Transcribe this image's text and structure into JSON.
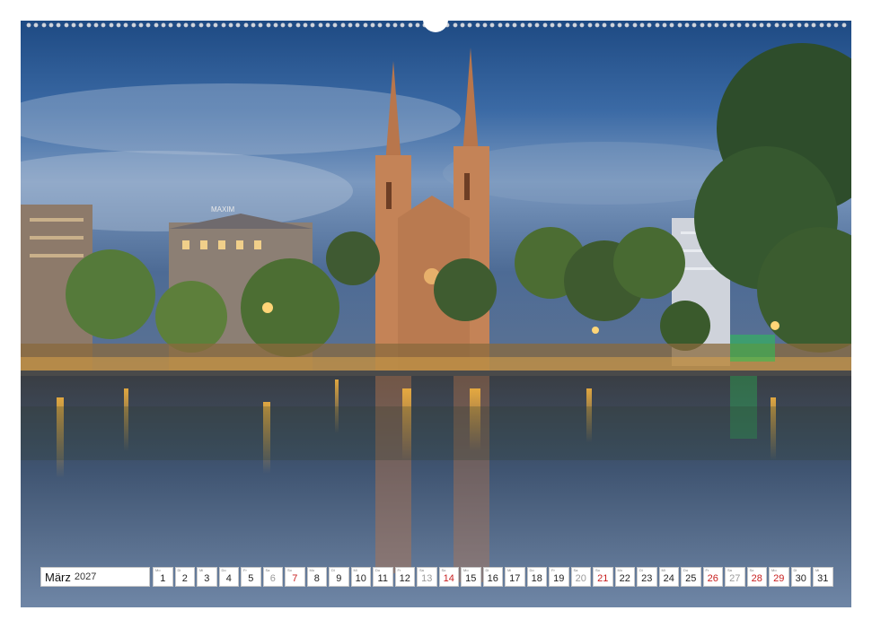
{
  "photo": {
    "description_icon": "city-night-church-reflection",
    "hotel_sign": "MAXIM"
  },
  "calendar": {
    "month": "März",
    "year": "2027",
    "days": [
      {
        "wd": "Mo",
        "n": "1",
        "type": "wd"
      },
      {
        "wd": "Di",
        "n": "2",
        "type": "wd"
      },
      {
        "wd": "Mi",
        "n": "3",
        "type": "wd"
      },
      {
        "wd": "Do",
        "n": "4",
        "type": "wd"
      },
      {
        "wd": "Fr",
        "n": "5",
        "type": "wd"
      },
      {
        "wd": "Sa",
        "n": "6",
        "type": "sat"
      },
      {
        "wd": "So",
        "n": "7",
        "type": "sun"
      },
      {
        "wd": "Mo",
        "n": "8",
        "type": "wd"
      },
      {
        "wd": "Di",
        "n": "9",
        "type": "wd"
      },
      {
        "wd": "Mi",
        "n": "10",
        "type": "wd"
      },
      {
        "wd": "Do",
        "n": "11",
        "type": "wd"
      },
      {
        "wd": "Fr",
        "n": "12",
        "type": "wd"
      },
      {
        "wd": "Sa",
        "n": "13",
        "type": "sat"
      },
      {
        "wd": "So",
        "n": "14",
        "type": "sun"
      },
      {
        "wd": "Mo",
        "n": "15",
        "type": "wd"
      },
      {
        "wd": "Di",
        "n": "16",
        "type": "wd"
      },
      {
        "wd": "Mi",
        "n": "17",
        "type": "wd"
      },
      {
        "wd": "Do",
        "n": "18",
        "type": "wd"
      },
      {
        "wd": "Fr",
        "n": "19",
        "type": "wd"
      },
      {
        "wd": "Sa",
        "n": "20",
        "type": "sat"
      },
      {
        "wd": "So",
        "n": "21",
        "type": "sun"
      },
      {
        "wd": "Mo",
        "n": "22",
        "type": "wd"
      },
      {
        "wd": "Di",
        "n": "23",
        "type": "wd"
      },
      {
        "wd": "Mi",
        "n": "24",
        "type": "wd"
      },
      {
        "wd": "Do",
        "n": "25",
        "type": "wd"
      },
      {
        "wd": "Fr",
        "n": "26",
        "type": "sun"
      },
      {
        "wd": "Sa",
        "n": "27",
        "type": "sat"
      },
      {
        "wd": "So",
        "n": "28",
        "type": "sun"
      },
      {
        "wd": "Mo",
        "n": "29",
        "type": "sun"
      },
      {
        "wd": "Di",
        "n": "30",
        "type": "wd"
      },
      {
        "wd": "Mi",
        "n": "31",
        "type": "wd"
      }
    ]
  },
  "colors": {
    "sunday": "#c81e1e",
    "saturday": "#9a9a9a",
    "weekday": "#222222"
  }
}
